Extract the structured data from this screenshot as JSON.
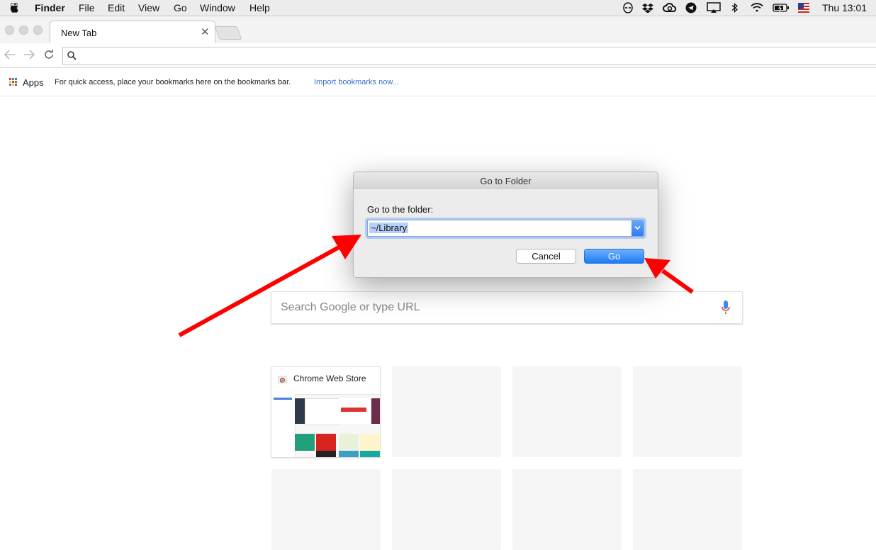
{
  "menubar": {
    "app_name": "Finder",
    "items": [
      "File",
      "Edit",
      "View",
      "Go",
      "Window",
      "Help"
    ],
    "clock": "Thu 13:01",
    "status_icons": [
      "alien-icon",
      "dropbox-icon",
      "creative-cloud-icon",
      "telegram-icon",
      "airplay-icon",
      "bluetooth-icon",
      "wifi-icon",
      "battery-icon",
      "us-flag-icon"
    ]
  },
  "browser": {
    "tab_title": "New Tab",
    "tab_close": "✕",
    "bookmarks": {
      "apps_label": "Apps",
      "hint": "For quick access, place your bookmarks here on the bookmarks bar.",
      "import_link": "Import bookmarks now..."
    },
    "search_placeholder": "Search Google or type URL",
    "tiles": [
      {
        "title": "Chrome Web Store"
      }
    ]
  },
  "dialog": {
    "title": "Go to Folder",
    "label": "Go to the folder:",
    "value": "~/Library",
    "cancel": "Cancel",
    "go": "Go"
  },
  "colors": {
    "annotation_arrow": "#ff0000",
    "primary_button": "#1b7cf5",
    "link": "#3b6fd0"
  }
}
